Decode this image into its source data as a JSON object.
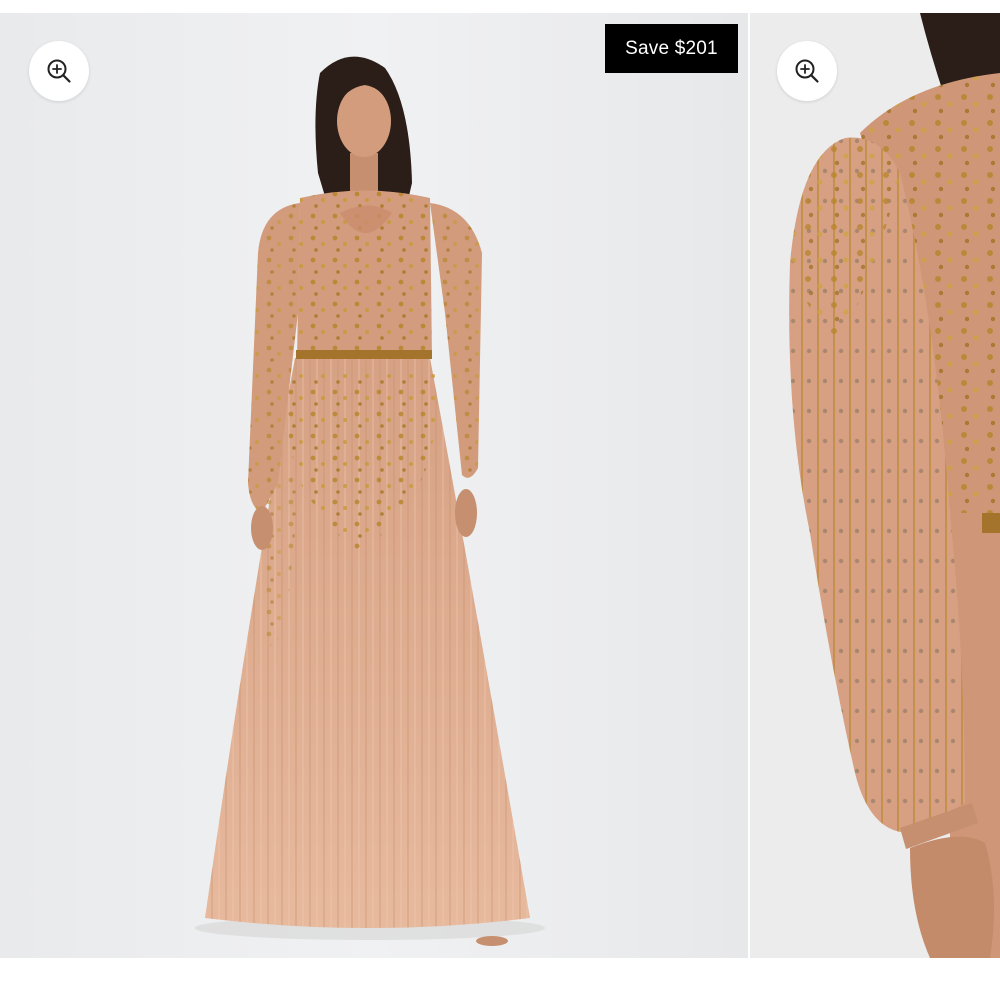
{
  "gallery": {
    "slides": [
      {
        "image": "full-length-beaded-gown-photo",
        "zoom_icon": "zoom-in-icon",
        "badge": "Save $201"
      },
      {
        "image": "sleeve-detail-closeup-photo",
        "zoom_icon": "zoom-in-icon"
      }
    ]
  },
  "colors": {
    "badge_background": "#000000",
    "badge_text": "#ffffff",
    "photo_background": "#eeeff0",
    "gown_base": "#d9a688",
    "gown_embellishment": "#b8862f"
  }
}
